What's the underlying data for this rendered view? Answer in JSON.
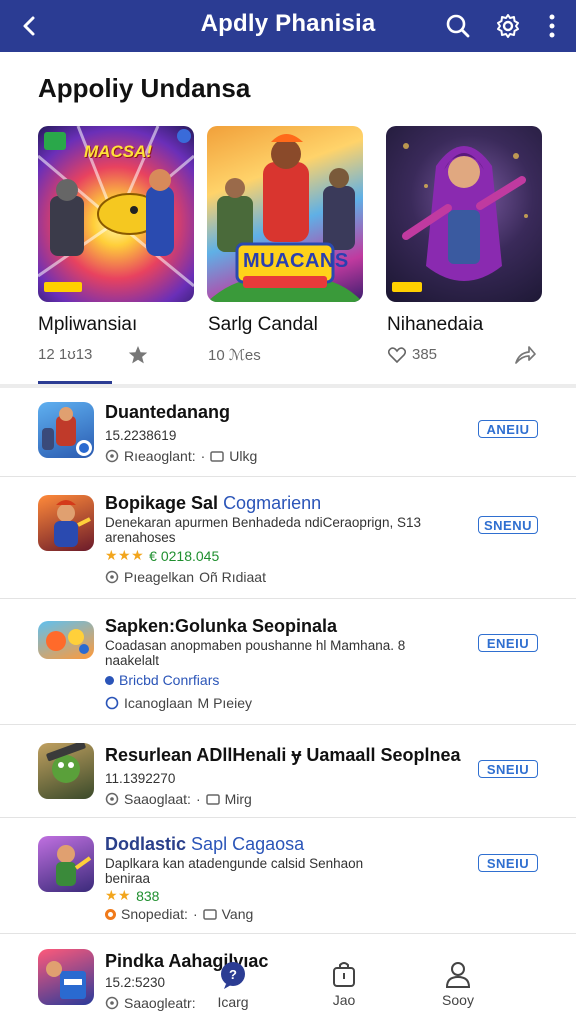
{
  "appbar": {
    "title": "Apdly Phanisia",
    "back_icon": "back-arrow-icon",
    "search_icon": "search-icon",
    "settings_icon": "gear-icon",
    "more_icon": "more-vertical-icon",
    "color": "#2b3c93"
  },
  "featured": {
    "title": "Appoliy Undansa",
    "cards": [
      {
        "name": "Mpliwansiaı",
        "meta": "12 1ʊ13",
        "action_icon": "star-icon",
        "cover_text": "MACSA!"
      },
      {
        "name": "Sarlg Candal",
        "meta": "10 ℳes",
        "action_icon": "",
        "cover_text": "MUACANS"
      },
      {
        "name": "Nihanedaia",
        "meta": "385",
        "meta_icon": "heart-icon",
        "action_icon": "share-icon"
      }
    ]
  },
  "list": [
    {
      "title": "Duantedanang",
      "line1": "15.2238619",
      "meta_a": "Rıeaoglant:",
      "meta_b": "Ulkg",
      "button": "ANEIU"
    },
    {
      "title": "Bopikage Sal",
      "title_blue": "Cogmarienn",
      "line1": "Denekaran apurmen Benhadeda ndiCeraoprign, S13",
      "line2": "arenahoses",
      "rating_text": "€ 0218.045",
      "meta_a": "Pıeagelkan",
      "meta_b": "Oñ Rıdiaat",
      "button": "SNENU"
    },
    {
      "title": "Sapken:Golunka Seopinala",
      "line1": "Coadasan anopmaben poushanne hl Mamhana. 8",
      "line2": "naakelalt",
      "link_text": "Bricbd Conrfiars",
      "meta_a": "Icanoglaan",
      "meta_b": "M Pıeiey",
      "button": "ENEIU"
    },
    {
      "title": "Resurlean ADllHenali ɏ Uamaall Seoplnea",
      "line1": "11.1392270",
      "meta_a": "Saaoglaat:",
      "meta_b": "Mirg",
      "button": "SNEIU"
    },
    {
      "title": "Dodlastic",
      "title_blue": "Sapl Cagaosa",
      "line1": "Daplkara kan atadengunde calsid Senhaon",
      "line2": "beniraa",
      "rating_text": "838",
      "meta_a": "Snopediat:",
      "meta_b": "Vang",
      "button": "SNEIU"
    },
    {
      "title": "Pindka Aahagilvıac",
      "line1": "15.2:5230",
      "meta_a": "Saaogleatr:",
      "meta_b": "Icarg"
    }
  ],
  "bottomnav": {
    "items": [
      {
        "label": "Icarg",
        "icon": "chat-bubble-icon"
      },
      {
        "label": "Jao",
        "icon": "bag-icon"
      },
      {
        "label": "Sooy",
        "icon": "person-icon"
      }
    ]
  }
}
